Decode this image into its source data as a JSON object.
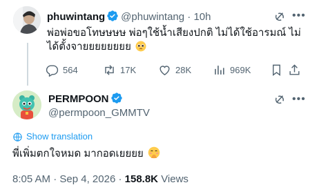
{
  "colors": {
    "accent": "#1d9bf0",
    "text_primary": "#0f1419",
    "text_secondary": "#536471",
    "thread_line": "#cfd9de"
  },
  "parent_tweet": {
    "display_name": "phuwintang",
    "handle": "@phuwintang",
    "separator": "·",
    "time": "10h",
    "text": "พ่อพ่อขอโทษษษษ พ่อๆใช้น้ำเสียงปกติ ไม่ได้ใช้อารมณ์ ไม่ได้ตั้งจายยยยยยยย",
    "emoji": "pleading-face",
    "stats": {
      "replies": "564",
      "reposts": "17K",
      "likes": "28K",
      "views": "969K"
    },
    "icons": [
      "reply-icon",
      "repost-icon",
      "like-icon",
      "views-icon",
      "bookmark-icon",
      "share-icon",
      "grok-icon",
      "more-icon"
    ]
  },
  "main_tweet": {
    "display_name": "PERMPOON",
    "handle": "@permpoon_GMMTV",
    "show_translation": "Show translation",
    "text": "พี่เพิ่มตกใจหมด มากอดเยยยย",
    "emoji": "blushing-hands-face",
    "time": "8:05 AM",
    "date": "Sep 4, 2026",
    "separator": "·",
    "views_count": "158.8K",
    "views_label": "Views"
  }
}
